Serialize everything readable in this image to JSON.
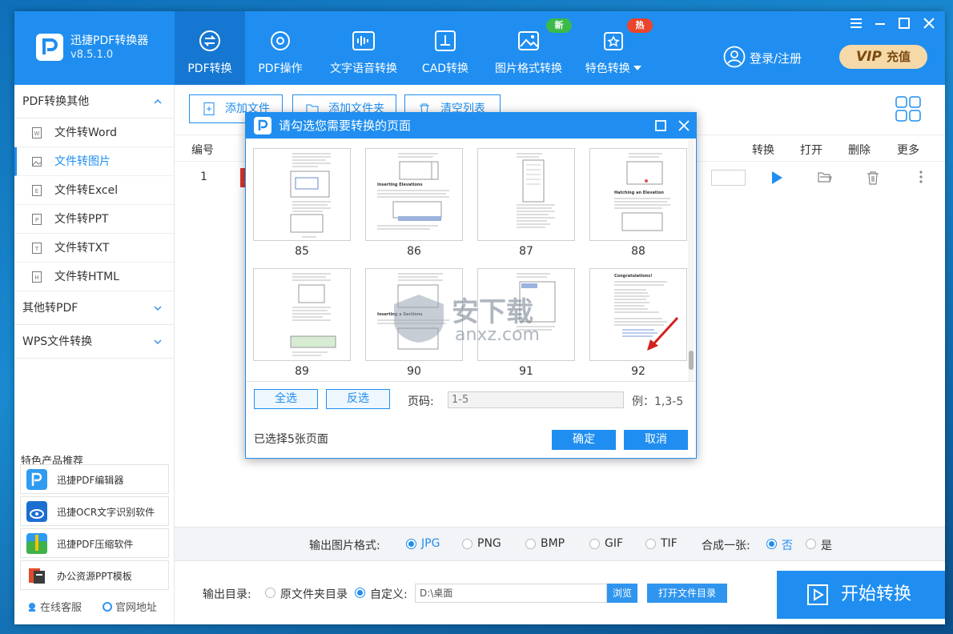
{
  "app": {
    "name": "迅捷PDF转换器",
    "version": "v8.5.1.0"
  },
  "nav": [
    {
      "label": "PDF转换",
      "icon": "swap-icon"
    },
    {
      "label": "PDF操作",
      "icon": "gear-icon"
    },
    {
      "label": "文字语音转换",
      "icon": "voice-wave-icon"
    },
    {
      "label": "CAD转换",
      "icon": "cad-icon"
    },
    {
      "label": "图片格式转换",
      "icon": "image-icon"
    },
    {
      "label": "特色转换",
      "icon": "star-convert-icon"
    }
  ],
  "badges": {
    "new": "新",
    "hot": "热"
  },
  "header": {
    "login": "登录/注册",
    "vip_text": "VIP",
    "vip_label": "充值"
  },
  "sidebar": {
    "sections": [
      {
        "label": "PDF转换其他"
      },
      {
        "label": "其他转PDF"
      },
      {
        "label": "WPS文件转换"
      }
    ],
    "items": [
      {
        "label": "文件转Word",
        "glyph": "W"
      },
      {
        "label": "文件转图片",
        "glyph": ""
      },
      {
        "label": "文件转Excel",
        "glyph": "E"
      },
      {
        "label": "文件转PPT",
        "glyph": "P"
      },
      {
        "label": "文件转TXT",
        "glyph": "T"
      },
      {
        "label": "文件转HTML",
        "glyph": "H"
      }
    ],
    "recommend_title": "特色产品推荐",
    "recommend": [
      {
        "label": "迅捷PDF编辑器",
        "icon": "pdf-editor-icon"
      },
      {
        "label": "迅捷OCR文字识别软件",
        "icon": "ocr-icon"
      },
      {
        "label": "迅捷PDF压缩软件",
        "icon": "zip-icon"
      },
      {
        "label": "办公资源PPT模板",
        "icon": "ppt-template-icon"
      }
    ],
    "service": "在线客服",
    "website": "官网地址"
  },
  "toolbar": {
    "add_file": "添加文件",
    "add_folder": "添加文件夹",
    "clear_list": "清空列表"
  },
  "table": {
    "headers": {
      "number": "编号",
      "convert": "转换",
      "open": "打开",
      "delete": "删除",
      "more": "更多"
    },
    "rows": [
      {
        "number": "1"
      }
    ]
  },
  "output_format": {
    "label": "输出图片格式:",
    "options": [
      "JPG",
      "PNG",
      "BMP",
      "GIF",
      "TIF"
    ],
    "selected": "JPG",
    "merge_label": "合成一张:",
    "merge_options": [
      "否",
      "是"
    ],
    "merge_selected": "否"
  },
  "output_dir": {
    "label": "输出目录:",
    "original": "原文件夹目录",
    "custom": "自定义:",
    "path": "D:\\桌面",
    "browse": "浏览",
    "open_dir": "打开文件目录"
  },
  "start_button": "开始转换",
  "dialog": {
    "title": "请勾选您需要转换的页面",
    "pages": [
      "85",
      "86",
      "87",
      "88",
      "89",
      "90",
      "91",
      "92"
    ],
    "page_headings": {
      "86": "Inserting Elevations",
      "88": "Hatching an Elevation",
      "90": "Inserting a Sections",
      "92": "Congratulations!"
    },
    "select_all": "全选",
    "invert": "反选",
    "page_label": "页码:",
    "page_value": "1-5",
    "example": "例：1,3-5",
    "selected_count": "已选择5张页面",
    "ok": "确定",
    "cancel": "取消"
  },
  "watermark": {
    "cn": "安下载",
    "en": "anxz.com"
  },
  "colors": {
    "primary": "#1f8ef0",
    "nav_active": "#1577d2",
    "badge_new": "#3cb94a",
    "badge_hot": "#e8452c",
    "vip_bg": "#f6d9a8",
    "arrow": "#d42020"
  }
}
